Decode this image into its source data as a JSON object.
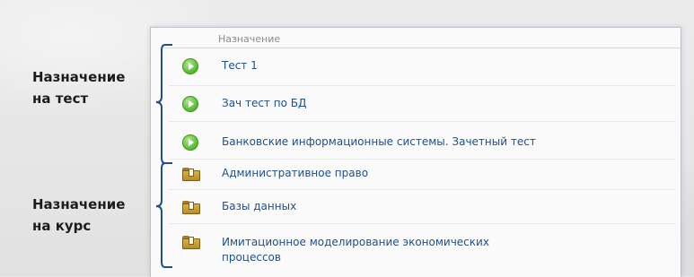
{
  "column_header": "Назначение",
  "callouts": {
    "test": {
      "line1": "Назначение",
      "line2": "на тест"
    },
    "course": {
      "line1": "Назначение",
      "line2": "на курс"
    }
  },
  "rows": [
    {
      "label": "Тест 1",
      "icon": "play-circle-icon"
    },
    {
      "label": "Зач тест по БД",
      "icon": "play-circle-icon"
    },
    {
      "label": "Банковские информационные системы. Зачетный тест",
      "icon": "play-circle-icon"
    },
    {
      "label": "Административное право",
      "icon": "folder-icon"
    },
    {
      "label": "Базы данных",
      "icon": "folder-icon"
    },
    {
      "label": "Имитационное моделирование экономических",
      "label_line2": "процессов",
      "icon": "folder-icon"
    }
  ],
  "colors": {
    "link": "#1e4f8f",
    "play_icon": "#5fbf3a",
    "folder_icon": "#c99f3a",
    "bracket": "#1f4e8c"
  }
}
